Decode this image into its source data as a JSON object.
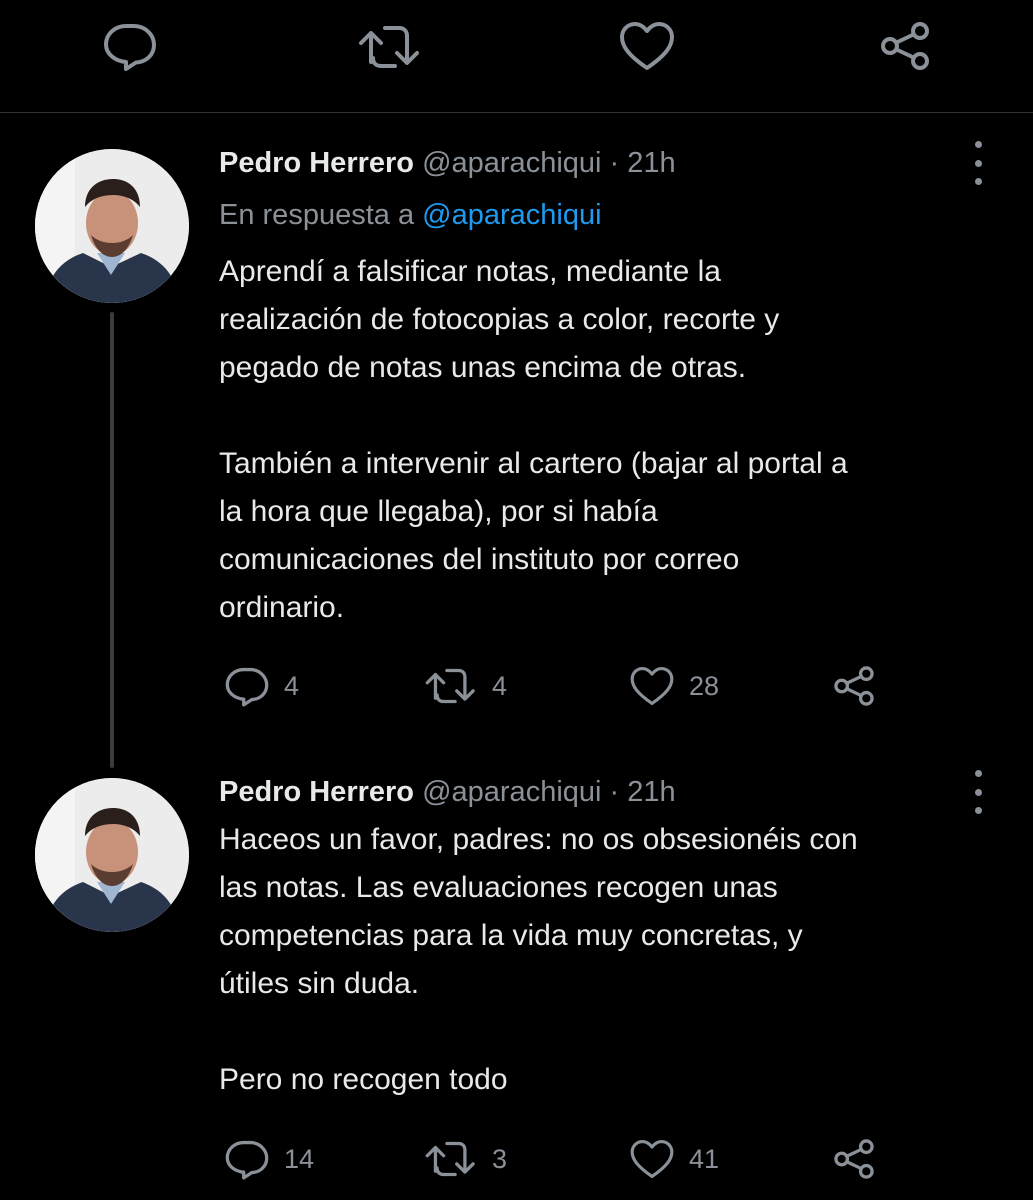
{
  "top_actions": {
    "reply_icon": "reply-icon",
    "retweet_icon": "retweet-icon",
    "like_icon": "like-icon",
    "share_icon": "share-icon"
  },
  "colors": {
    "background": "#000000",
    "text": "#e7e9ea",
    "muted": "#8b9198",
    "link": "#1d9bf0"
  },
  "tweets": [
    {
      "name": "Pedro Herrero",
      "handle": "@aparachiqui",
      "sep": "·",
      "time": "21h",
      "reply_prefix": "En respuesta a ",
      "reply_mention": "@aparachiqui",
      "text": "Aprendí a falsificar notas, mediante la\nrealización de fotocopias a color, recorte y\npegado de notas unas encima de otras.\n\nTambién a intervenir al cartero (bajar al portal a\nla hora que llegaba), por si había\ncomunicaciones del instituto por correo\nordinario.",
      "replies": "4",
      "retweets": "4",
      "likes": "28"
    },
    {
      "name": "Pedro Herrero",
      "handle": "@aparachiqui",
      "sep": "·",
      "time": "21h",
      "text": "Haceos un favor, padres: no os obsesionéis con\nlas notas. Las evaluaciones recogen unas\ncompetencias para la vida muy concretas, y\nútiles sin duda.\n\nPero no recogen todo",
      "replies": "14",
      "retweets": "3",
      "likes": "41"
    }
  ]
}
